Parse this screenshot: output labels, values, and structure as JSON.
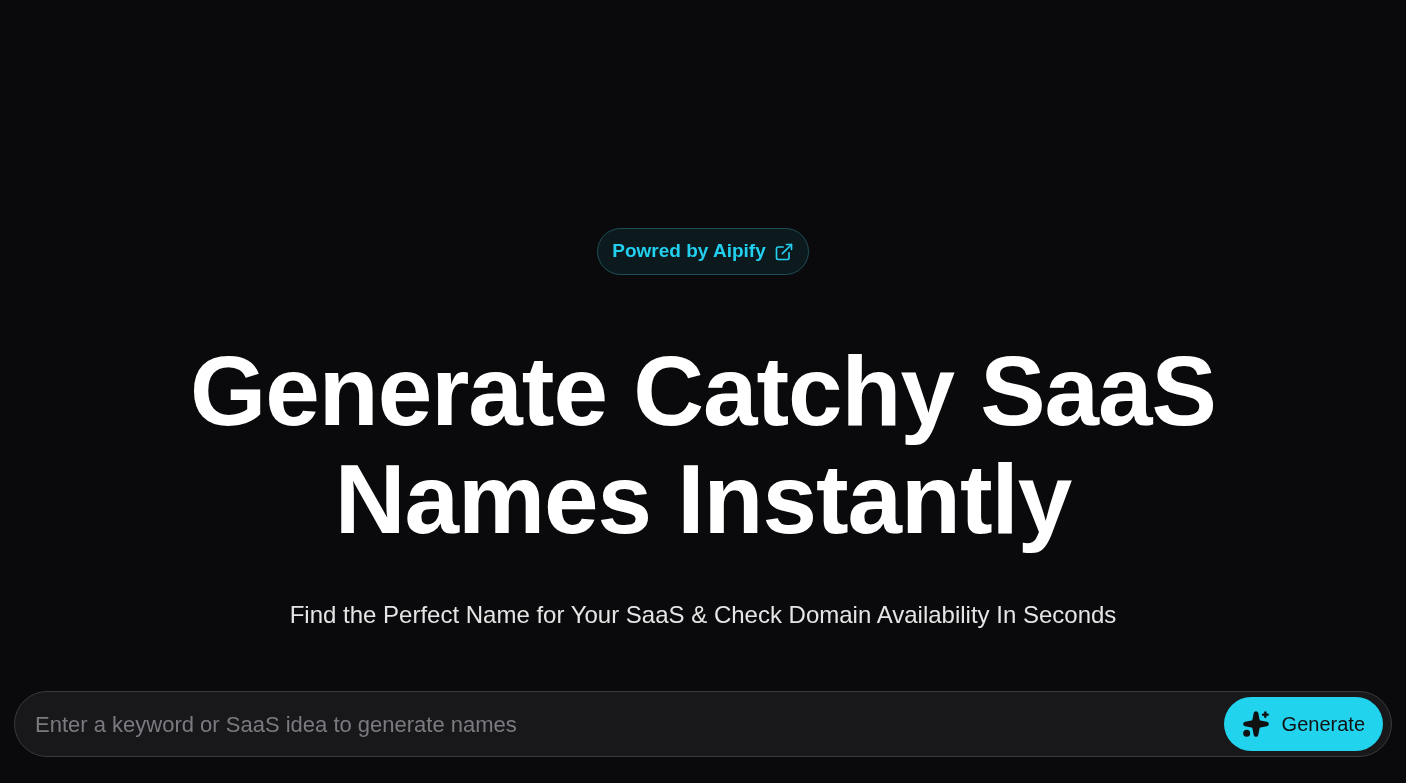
{
  "badge": {
    "label": "Powred by Aipify"
  },
  "heading": {
    "lines": [
      "Generate Catchy SaaS",
      "Names Instantly"
    ]
  },
  "subheading": "Find the Perfect Name for Your SaaS & Check Domain Availability In Seconds",
  "search": {
    "placeholder": "Enter a keyword or SaaS idea to generate names",
    "button": "Generate"
  }
}
